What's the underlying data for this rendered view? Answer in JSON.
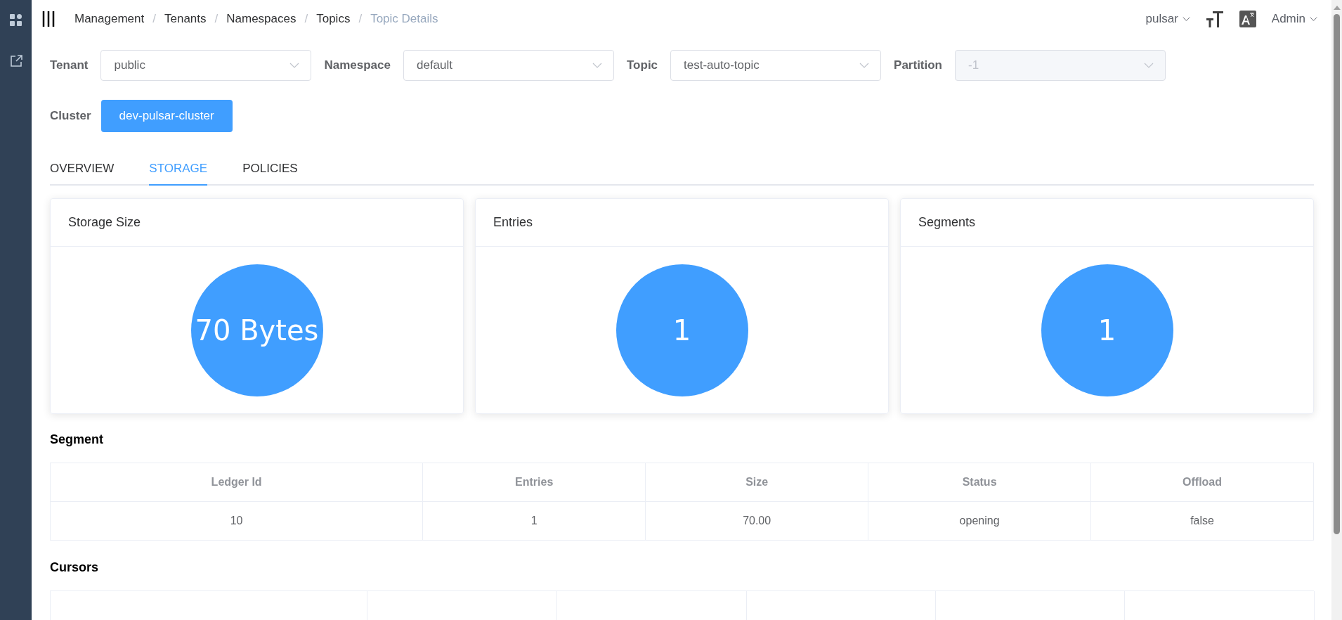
{
  "breadcrumb": [
    {
      "label": "Management",
      "current": false
    },
    {
      "label": "Tenants",
      "current": false
    },
    {
      "label": "Namespaces",
      "current": false
    },
    {
      "label": "Topics",
      "current": false
    },
    {
      "label": "Topic Details",
      "current": true
    }
  ],
  "breadcrumb_separator": "/",
  "header": {
    "cluster_menu": "pulsar",
    "user_menu": "Admin"
  },
  "filters": [
    {
      "label": "Tenant",
      "value": "public",
      "disabled": false
    },
    {
      "label": "Namespace",
      "value": "default",
      "disabled": false
    },
    {
      "label": "Topic",
      "value": "test-auto-topic",
      "disabled": false
    },
    {
      "label": "Partition",
      "value": "-1",
      "disabled": true
    }
  ],
  "cluster": {
    "label": "Cluster",
    "button": "dev-pulsar-cluster"
  },
  "tabs": [
    {
      "label": "OVERVIEW",
      "selected": false
    },
    {
      "label": "STORAGE",
      "selected": true
    },
    {
      "label": "POLICIES",
      "selected": false
    }
  ],
  "cards": [
    {
      "title": "Storage Size",
      "value": "70 Bytes"
    },
    {
      "title": "Entries",
      "value": "1"
    },
    {
      "title": "Segments",
      "value": "1"
    }
  ],
  "segment": {
    "title": "Segment",
    "columns": [
      "Ledger Id",
      "Entries",
      "Size",
      "Status",
      "Offload"
    ],
    "rows": [
      [
        "10",
        "1",
        "70.00",
        "opening",
        "false"
      ]
    ]
  },
  "cursors": {
    "title": "Cursors"
  }
}
